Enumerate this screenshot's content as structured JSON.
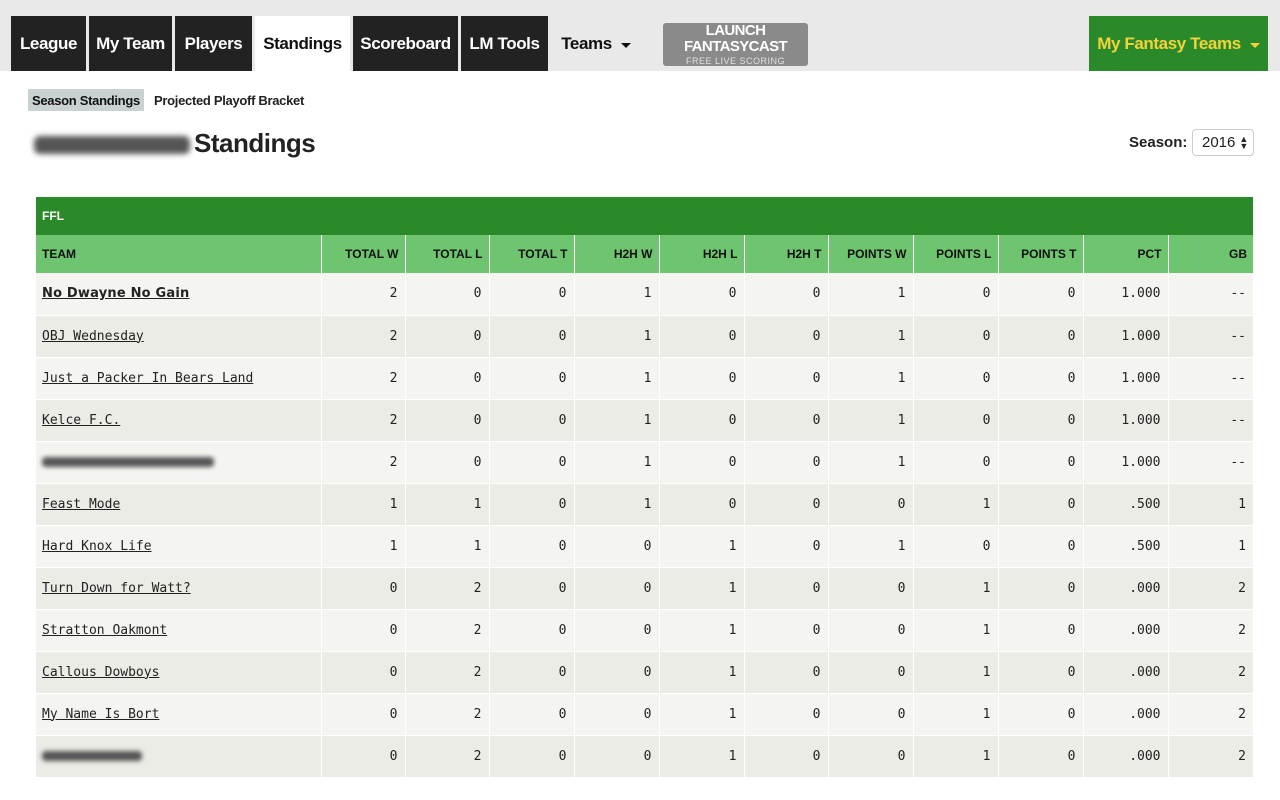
{
  "nav": {
    "tabs": [
      {
        "label": "League"
      },
      {
        "label": "My Team"
      },
      {
        "label": "Players"
      },
      {
        "label": "Standings"
      },
      {
        "label": "Scoreboard"
      },
      {
        "label": "LM Tools"
      },
      {
        "label": "Teams"
      }
    ],
    "launch": {
      "title": "LAUNCH FANTASYCAST",
      "subtitle": "FREE LIVE SCORING"
    },
    "my_fantasy_teams": "My Fantasy Teams"
  },
  "subtabs": [
    {
      "label": "Season Standings",
      "active": true
    },
    {
      "label": "Projected Playoff Bracket",
      "active": false
    }
  ],
  "page": {
    "title": "Standings",
    "season_label": "Season:",
    "season_value": "2016"
  },
  "standings": {
    "league_name": "FFL",
    "columns": [
      "TEAM",
      "TOTAL W",
      "TOTAL L",
      "TOTAL T",
      "H2H W",
      "H2H L",
      "H2H T",
      "POINTS W",
      "POINTS L",
      "POINTS T",
      "PCT",
      "GB"
    ],
    "rows": [
      {
        "team": "No Dwayne No Gain",
        "values": [
          "2",
          "0",
          "0",
          "1",
          "0",
          "0",
          "1",
          "0",
          "0",
          "1.000",
          "--"
        ]
      },
      {
        "team": "OBJ Wednesday",
        "values": [
          "2",
          "0",
          "0",
          "1",
          "0",
          "0",
          "1",
          "0",
          "0",
          "1.000",
          "--"
        ]
      },
      {
        "team": "Just a Packer In Bears Land",
        "values": [
          "2",
          "0",
          "0",
          "1",
          "0",
          "0",
          "1",
          "0",
          "0",
          "1.000",
          "--"
        ]
      },
      {
        "team": "Kelce F.C.",
        "values": [
          "2",
          "0",
          "0",
          "1",
          "0",
          "0",
          "1",
          "0",
          "0",
          "1.000",
          "--"
        ]
      },
      {
        "team": "",
        "values": [
          "2",
          "0",
          "0",
          "1",
          "0",
          "0",
          "1",
          "0",
          "0",
          "1.000",
          "--"
        ]
      },
      {
        "team": "Feast Mode",
        "values": [
          "1",
          "1",
          "0",
          "1",
          "0",
          "0",
          "0",
          "1",
          "0",
          ".500",
          "1"
        ]
      },
      {
        "team": "Hard Knox Life",
        "values": [
          "1",
          "1",
          "0",
          "0",
          "1",
          "0",
          "1",
          "0",
          "0",
          ".500",
          "1"
        ]
      },
      {
        "team": "Turn Down for Watt?",
        "values": [
          "0",
          "2",
          "0",
          "0",
          "1",
          "0",
          "0",
          "1",
          "0",
          ".000",
          "2"
        ]
      },
      {
        "team": "Stratton Oakmont",
        "values": [
          "0",
          "2",
          "0",
          "0",
          "1",
          "0",
          "0",
          "1",
          "0",
          ".000",
          "2"
        ]
      },
      {
        "team": "Callous Dowboys",
        "values": [
          "0",
          "2",
          "0",
          "0",
          "1",
          "0",
          "0",
          "1",
          "0",
          ".000",
          "2"
        ]
      },
      {
        "team": "My Name Is Bort",
        "values": [
          "0",
          "2",
          "0",
          "0",
          "1",
          "0",
          "0",
          "1",
          "0",
          ".000",
          "2"
        ]
      },
      {
        "team": "",
        "values": [
          "0",
          "2",
          "0",
          "0",
          "1",
          "0",
          "0",
          "1",
          "0",
          ".000",
          "2"
        ]
      }
    ]
  },
  "colors": {
    "nav_dark": "#222222",
    "brand_green": "#2a8a2a",
    "header_light_green": "#6fc46f",
    "my_teams_text": "#f3d23a"
  }
}
